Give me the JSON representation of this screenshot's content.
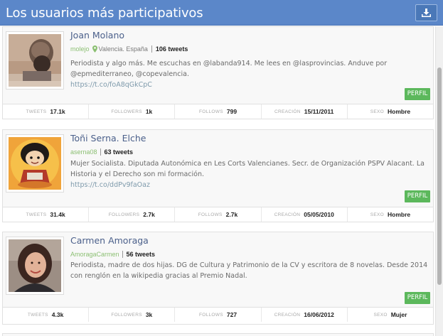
{
  "header": {
    "title": "Los usuarios más participativos"
  },
  "icons": {
    "download": "download-icon",
    "location": "map-pin-icon"
  },
  "colors": {
    "header_bg": "#5b87c9",
    "perfil_button": "#5cb85c",
    "handle": "#8bbf72"
  },
  "users": [
    {
      "name": "Joan Molano",
      "handle": "molejo",
      "location": "Valencia. España",
      "tweets_label": "106 tweets",
      "bio": "Periodista y algo más. Me escuchas en @labanda914. Me lees en @lasprovincias. Anduve por @epmediterraneo, @copevalencia.",
      "link": "https://t.co/foA8qGkCpC",
      "profile_button": "PERFIL",
      "stats": [
        {
          "label": "TWEETS",
          "value": "17.1k"
        },
        {
          "label": "FOLLOWERS",
          "value": "1k"
        },
        {
          "label": "FOLLOWS",
          "value": "799"
        },
        {
          "label": "CREACIÓN",
          "value": "15/11/2011"
        },
        {
          "label": "SEXO",
          "value": "Hombre"
        }
      ]
    },
    {
      "name": "Toñi Serna. Elche",
      "handle": "aserna08",
      "location": "",
      "tweets_label": "63 tweets",
      "bio": "Mujer Socialista. Diputada Autonómica en Les Corts Valencianes. Secr. de Organización PSPV Alacant. La Historia y el Derecho son mi formación.",
      "link": "https://t.co/ddPv9faOaz",
      "profile_button": "PERFIL",
      "stats": [
        {
          "label": "TWEETS",
          "value": "31.4k"
        },
        {
          "label": "FOLLOWERS",
          "value": "2.7k"
        },
        {
          "label": "FOLLOWS",
          "value": "2.7k"
        },
        {
          "label": "CREACIÓN",
          "value": "05/05/2010"
        },
        {
          "label": "SEXO",
          "value": "Hombre"
        }
      ]
    },
    {
      "name": "Carmen Amoraga",
      "handle": "AmoragaCarmen",
      "location": "",
      "tweets_label": "56 tweets",
      "bio": "Periodista, madre de dos hijas. DG de Cultura y Patrimonio de la CV y escritora de 8 novelas. Desde 2014 con renglón en la wikipedia gracias al Premio Nadal.",
      "link": "",
      "profile_button": "PERFIL",
      "stats": [
        {
          "label": "TWEETS",
          "value": "4.3k"
        },
        {
          "label": "FOLLOWERS",
          "value": "3k"
        },
        {
          "label": "FOLLOWS",
          "value": "727"
        },
        {
          "label": "CREACIÓN",
          "value": "16/06/2012"
        },
        {
          "label": "SEXO",
          "value": "Mujer"
        }
      ]
    }
  ]
}
